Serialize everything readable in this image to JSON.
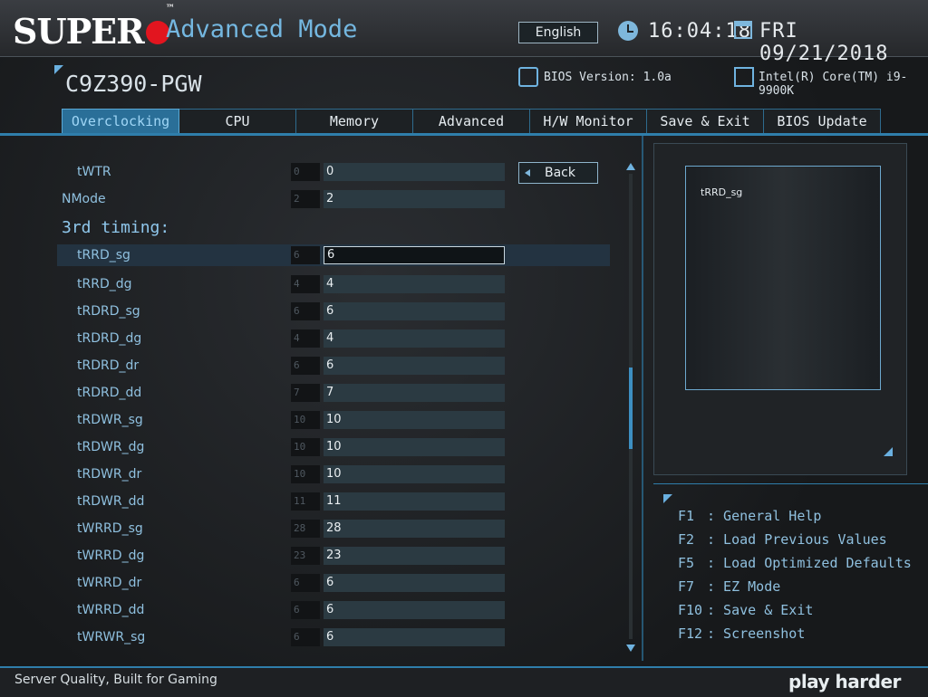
{
  "header": {
    "logo_text": "SUPER",
    "logo_tm": "™",
    "mode": "Advanced Mode",
    "language": "English",
    "time": "16:04:18",
    "date": "FRI 09/21/2018"
  },
  "system": {
    "model": "C9Z390-PGW",
    "bios_version": "BIOS Version: 1.0a",
    "cpu": "Intel(R) Core(TM) i9-9900K"
  },
  "tabs": [
    {
      "label": "Overclocking",
      "active": true
    },
    {
      "label": "CPU",
      "active": false
    },
    {
      "label": "Memory",
      "active": false
    },
    {
      "label": "Advanced",
      "active": false
    },
    {
      "label": "H/W Monitor",
      "active": false
    },
    {
      "label": "Save & Exit",
      "active": false
    },
    {
      "label": "BIOS Update",
      "active": false
    }
  ],
  "back_label": "Back",
  "section_title": "3rd timing:",
  "settings": [
    {
      "label": "tWTR",
      "default": "0",
      "value": "0"
    },
    {
      "label": "NMode",
      "default": "2",
      "value": "2"
    },
    {
      "label": "tRRD_sg",
      "default": "6",
      "value": "6"
    },
    {
      "label": "tRRD_dg",
      "default": "4",
      "value": "4"
    },
    {
      "label": "tRDRD_sg",
      "default": "6",
      "value": "6"
    },
    {
      "label": "tRDRD_dg",
      "default": "4",
      "value": "4"
    },
    {
      "label": "tRDRD_dr",
      "default": "6",
      "value": "6"
    },
    {
      "label": "tRDRD_dd",
      "default": "7",
      "value": "7"
    },
    {
      "label": "tRDWR_sg",
      "default": "10",
      "value": "10"
    },
    {
      "label": "tRDWR_dg",
      "default": "10",
      "value": "10"
    },
    {
      "label": "tRDWR_dr",
      "default": "10",
      "value": "10"
    },
    {
      "label": "tRDWR_dd",
      "default": "11",
      "value": "11"
    },
    {
      "label": "tWRRD_sg",
      "default": "28",
      "value": "28"
    },
    {
      "label": "tWRRD_dg",
      "default": "23",
      "value": "23"
    },
    {
      "label": "tWRRD_dr",
      "default": "6",
      "value": "6"
    },
    {
      "label": "tWRRD_dd",
      "default": "6",
      "value": "6"
    },
    {
      "label": "tWRWR_sg",
      "default": "6",
      "value": "6"
    }
  ],
  "help_text": "tRRD_sg",
  "hotkeys": [
    {
      "key": "F1",
      "desc": ": General Help"
    },
    {
      "key": "F2",
      "desc": ": Load Previous Values"
    },
    {
      "key": "F5",
      "desc": ": Load Optimized Defaults"
    },
    {
      "key": "F7",
      "desc": ": EZ Mode"
    },
    {
      "key": "F10",
      "desc": ": Save & Exit"
    },
    {
      "key": "F12",
      "desc": ": Screenshot"
    }
  ],
  "footer": {
    "tagline": "Server Quality, Built for Gaming",
    "brand": "play harder"
  },
  "colors": {
    "accent": "#2f7eab",
    "label": "#8fc0df",
    "logo_red": "#e2151f"
  }
}
